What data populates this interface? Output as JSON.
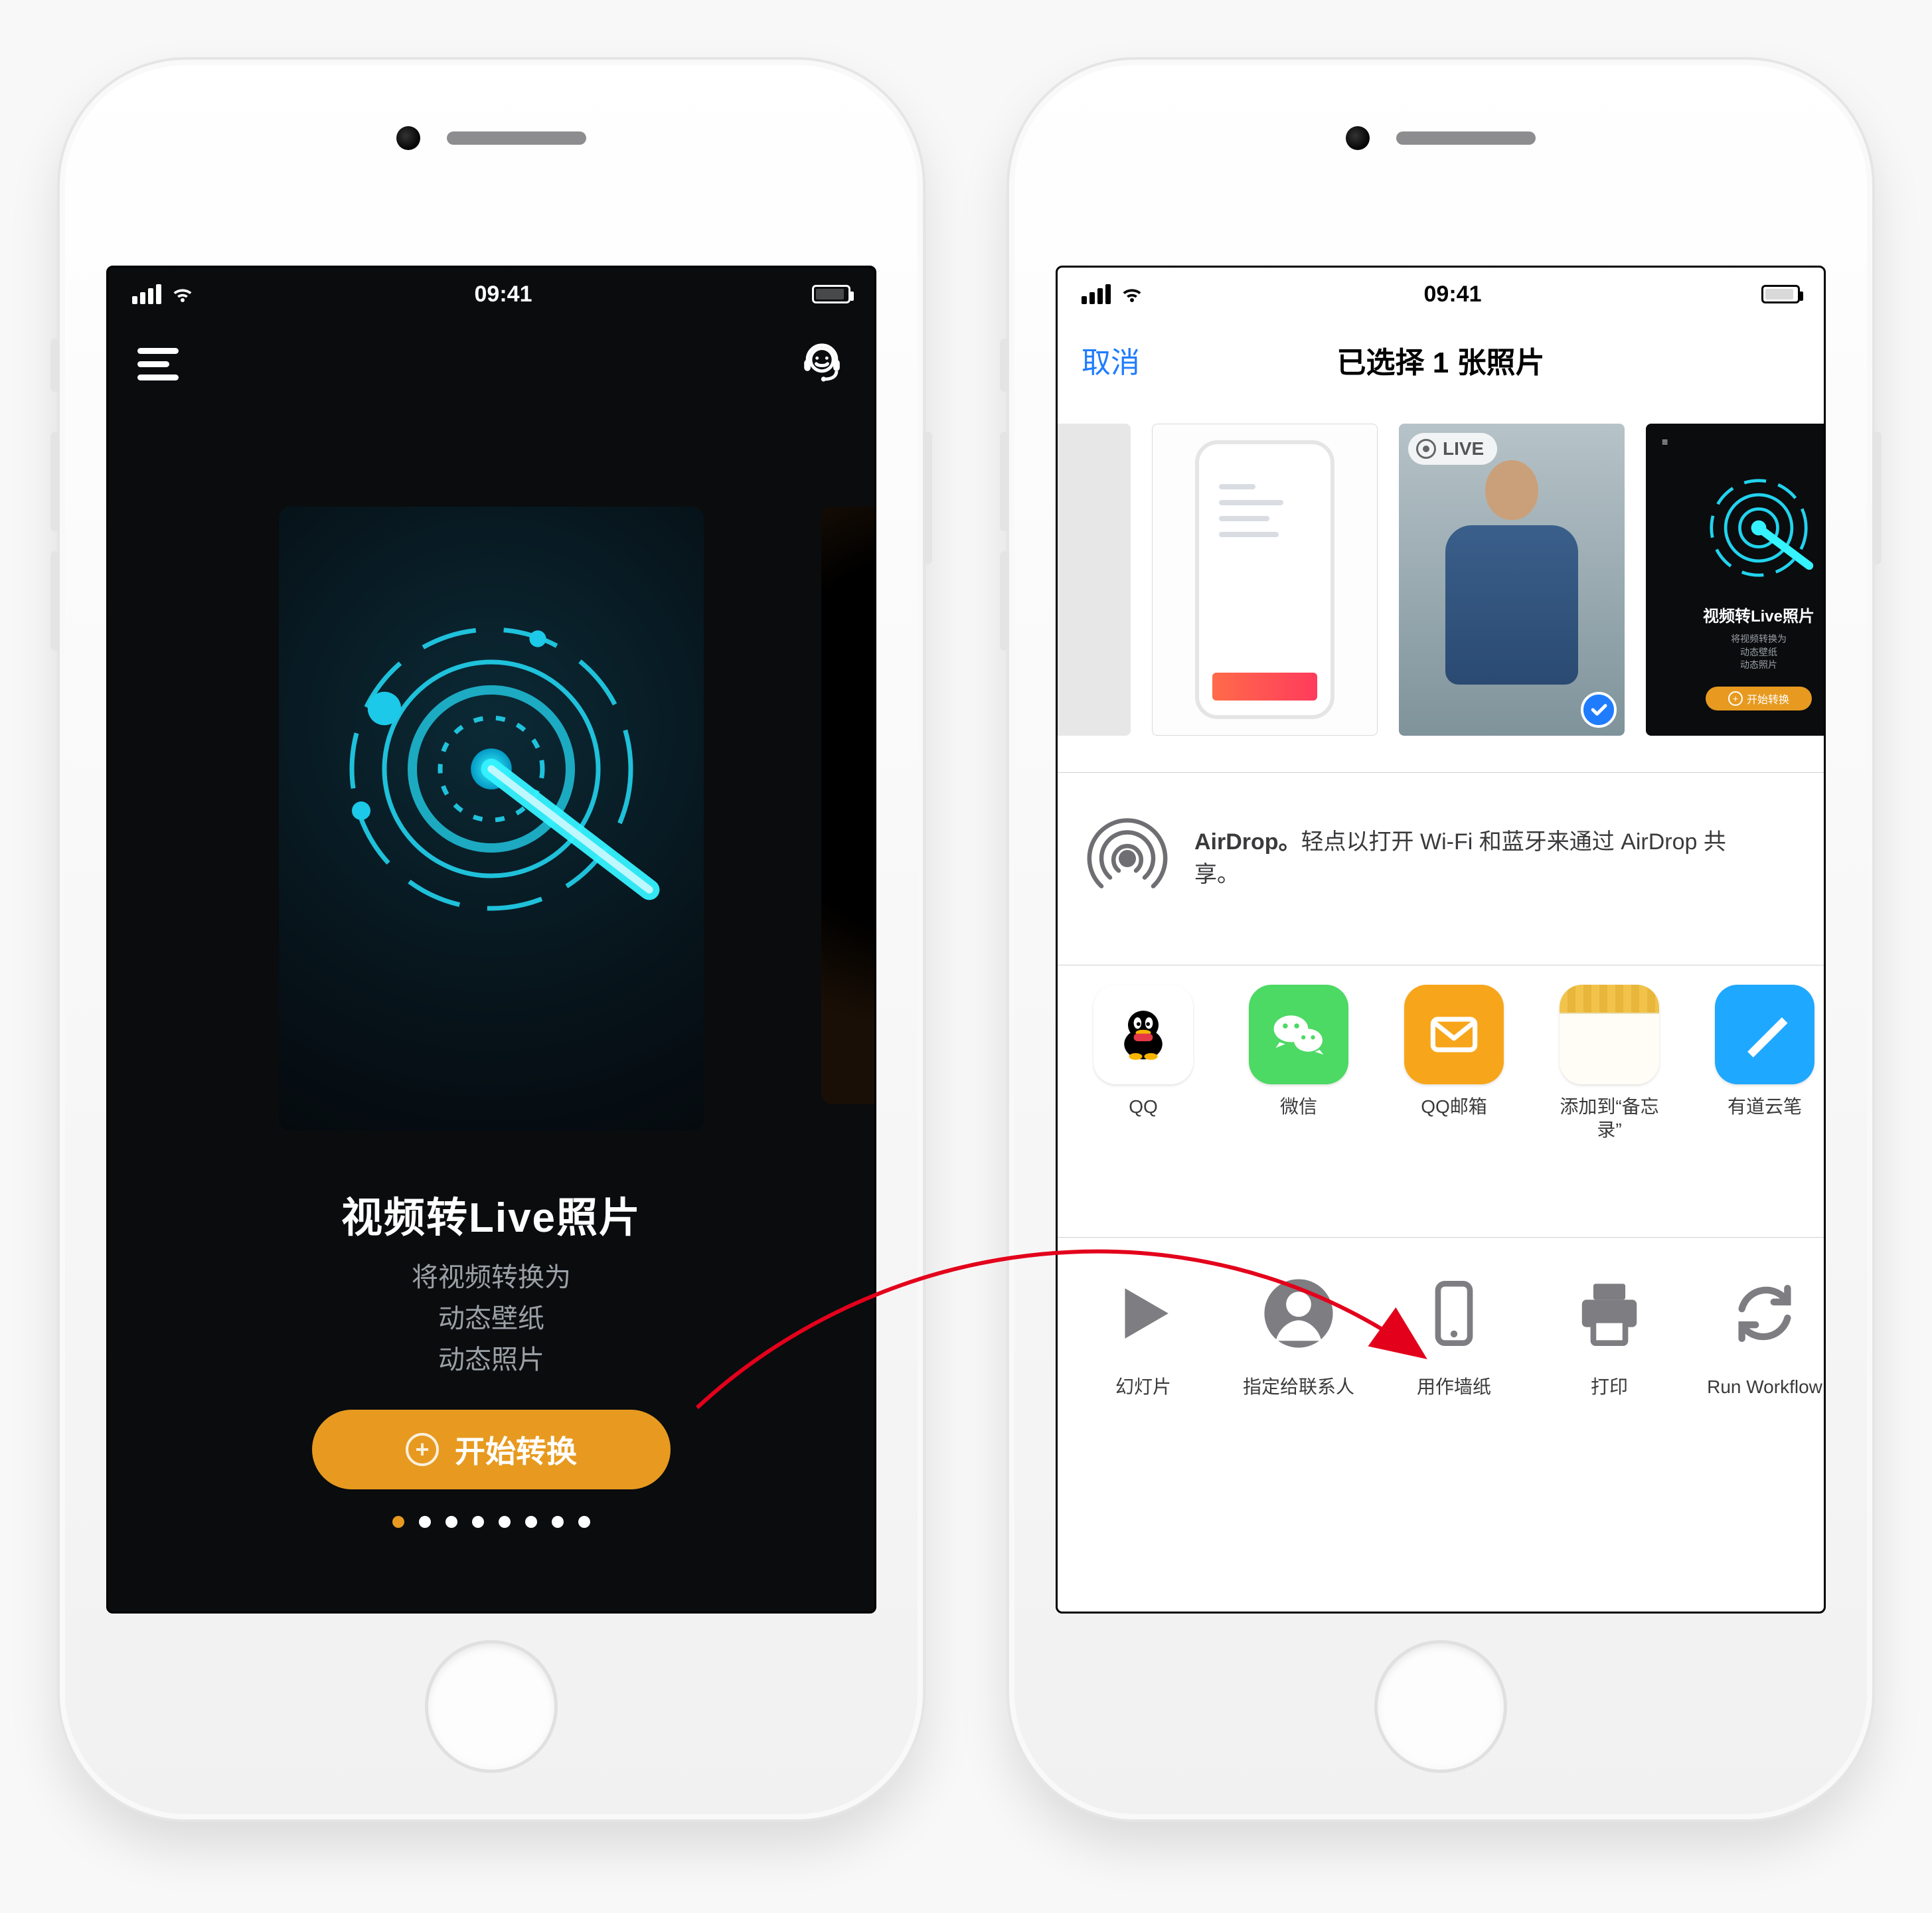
{
  "status": {
    "time": "09:41"
  },
  "left_app": {
    "title": "视频转Live照片",
    "subtitle_lines": [
      "将视频转换为",
      "动态壁纸",
      "动态照片"
    ],
    "cta_label": "开始转换",
    "page_index": 0,
    "page_count": 8
  },
  "share_sheet": {
    "cancel": "取消",
    "title": "已选择 1 张照片",
    "thumbs": {
      "live_badge": "LIVE",
      "mini_title": "视频转Live照片",
      "mini_sub_lines": [
        "将视频转换为",
        "动态壁纸",
        "动态照片"
      ],
      "mini_cta": "开始转换"
    },
    "airdrop": {
      "label": "AirDrop。",
      "text": "轻点以打开 Wi-Fi 和蓝牙来通过 AirDrop 共享。"
    },
    "apps": [
      {
        "id": "qq",
        "label": "QQ"
      },
      {
        "id": "wechat",
        "label": "微信"
      },
      {
        "id": "qqmail",
        "label": "QQ邮箱"
      },
      {
        "id": "notes",
        "label": "添加到“备忘录”"
      },
      {
        "id": "youdao",
        "label": "有道云笔"
      }
    ],
    "actions": [
      {
        "id": "slideshow",
        "label": "幻灯片"
      },
      {
        "id": "assign",
        "label": "指定给联系人"
      },
      {
        "id": "wallpaper",
        "label": "用作墙纸"
      },
      {
        "id": "print",
        "label": "打印"
      },
      {
        "id": "workflow",
        "label": "Run Workflow"
      }
    ]
  }
}
